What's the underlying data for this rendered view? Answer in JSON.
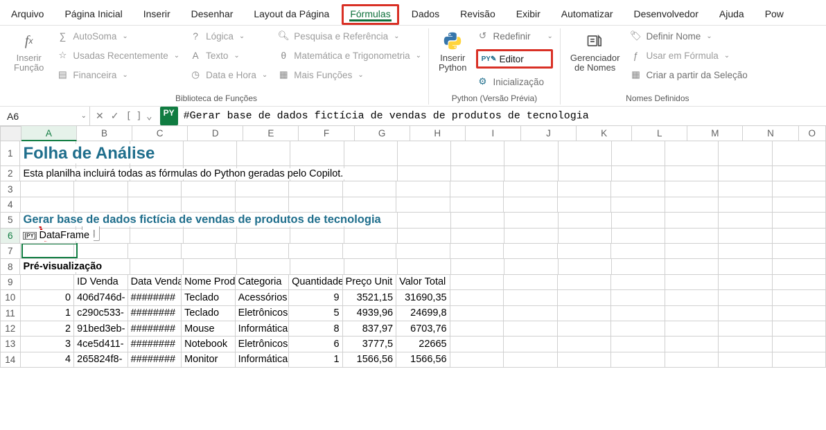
{
  "menu": {
    "items": [
      "Arquivo",
      "Página Inicial",
      "Inserir",
      "Desenhar",
      "Layout da Página",
      "Fórmulas",
      "Dados",
      "Revisão",
      "Exibir",
      "Automatizar",
      "Desenvolvedor",
      "Ajuda",
      "Pow"
    ],
    "active_index": 5
  },
  "ribbon": {
    "insert_func": "Inserir\nFunção",
    "autosoma": "AutoSoma",
    "usadas": "Usadas Recentemente",
    "financeira": "Financeira",
    "logica": "Lógica",
    "texto": "Texto",
    "datahora": "Data e Hora",
    "pesquisa": "Pesquisa e Referência",
    "mattrig": "Matemática e Trigonometria",
    "maisfunc": "Mais Funções",
    "biblioteca_label": "Biblioteca de Funções",
    "inserir_python": "Inserir\nPython",
    "redefinir": "Redefinir",
    "editor": "Editor",
    "inicial": "Inicialização",
    "python_label": "Python (Versão Prévia)",
    "ger_nomes": "Gerenciador\nde Nomes",
    "def_nome": "Definir Nome",
    "usar_form": "Usar em Fórmula",
    "criar_sel": "Criar a partir da Seleção",
    "nomes_label": "Nomes Definidos"
  },
  "namebox": "A6",
  "formula_comment": "#Gerar base de dados fictícia de vendas de produtos de tecnologia",
  "grid": {
    "cols": [
      "A",
      "B",
      "C",
      "D",
      "E",
      "F",
      "G",
      "H",
      "I",
      "J",
      "K",
      "L",
      "M",
      "N",
      "O"
    ],
    "title": "Folha de Análise",
    "subtitle_text": "Esta planilha incluirá todas as fórmulas do Python geradas pelo Copilot.",
    "section5": "Gerar base de dados fictícia de vendas de produtos de tecnologia",
    "a6": "DataFrame",
    "preview": "Pré-visualização",
    "headers": [
      "",
      "ID Venda",
      "Data Venda",
      "Nome Produto",
      "Categoria",
      "Quantidade",
      "Preço Unit",
      "Valor Total"
    ],
    "rows": [
      {
        "idx": "0",
        "id": "406d746d-",
        "data": "########",
        "nome": "Teclado",
        "cat": "Acessórios",
        "qtd": "9",
        "preco": "3521,15",
        "total": "31690,35"
      },
      {
        "idx": "1",
        "id": "c290c533-",
        "data": "########",
        "nome": "Teclado",
        "cat": "Eletrônicos",
        "qtd": "5",
        "preco": "4939,96",
        "total": "24699,8"
      },
      {
        "idx": "2",
        "id": "91bed3eb-",
        "data": "########",
        "nome": "Mouse",
        "cat": "Informática",
        "qtd": "8",
        "preco": "837,97",
        "total": "6703,76"
      },
      {
        "idx": "3",
        "id": "4ce5d411-",
        "data": "########",
        "nome": "Notebook",
        "cat": "Eletrônicos",
        "qtd": "6",
        "preco": "3777,5",
        "total": "22665"
      },
      {
        "idx": "4",
        "id": "265824f8-",
        "data": "########",
        "nome": "Monitor",
        "cat": "Informática",
        "qtd": "1",
        "preco": "1566,56",
        "total": "1566,56"
      }
    ]
  },
  "py_badge": "PY"
}
